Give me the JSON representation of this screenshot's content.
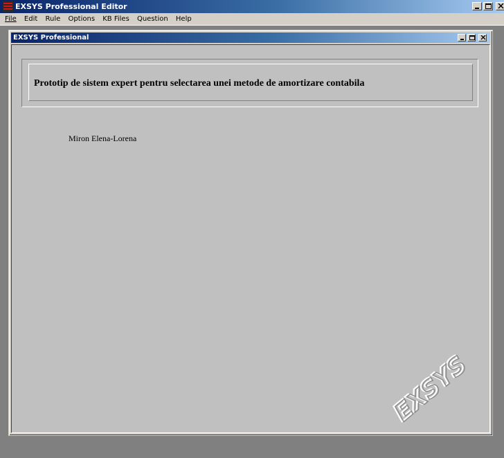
{
  "app": {
    "title": "EXSYS Professional Editor",
    "icon": "exsys-app-icon"
  },
  "menubar": {
    "items": [
      {
        "label": "File",
        "underline": "F"
      },
      {
        "label": "Edit",
        "underline": "E"
      },
      {
        "label": "Rule",
        "underline": "R"
      },
      {
        "label": "Options",
        "underline": "O"
      },
      {
        "label": "KB Files",
        "underline": "K"
      },
      {
        "label": "Question",
        "underline": "Q"
      },
      {
        "label": "Help",
        "underline": "H"
      }
    ]
  },
  "child_window": {
    "title": "EXSYS Professional",
    "heading": "Prototip de sistem expert pentru selectarea unei metode de amortizare contabila",
    "author": "Miron Elena-Lorena",
    "watermark_icon": "exsys-logo-watermark"
  },
  "colors": {
    "titlebar_start": "#0a246a",
    "titlebar_end": "#a6caf0",
    "face": "#d4d0c8",
    "client": "#c0c0c0",
    "desktop": "#808080"
  }
}
